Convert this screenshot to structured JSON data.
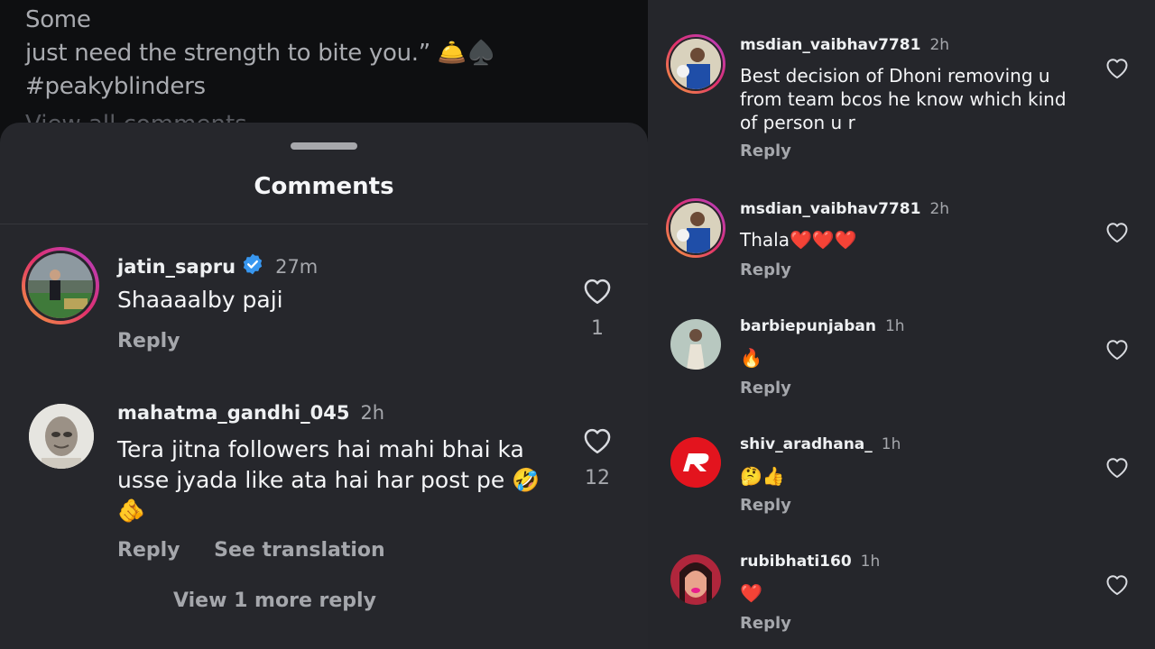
{
  "post": {
    "caption_line1": "Some",
    "caption_line2": "just need the strength to bite you.” 🛎️♠️",
    "hashtag": "#peakyblinders",
    "partial_link": "View all comments"
  },
  "sheet": {
    "title": "Comments",
    "comments": [
      {
        "username": "jatin_sapru",
        "verified": true,
        "time": "27m",
        "text": "Shaaaalby paji",
        "reply_label": "Reply",
        "likes": "1"
      },
      {
        "username": "mahatma_gandhi_045",
        "time": "2h",
        "text": "Tera jitna followers hai mahi bhai ka usse jyada like ata hai har post pe 🤣🫵",
        "reply_label": "Reply",
        "translation_label": "See translation",
        "likes": "12"
      }
    ],
    "view_more_label": "View 1 more reply"
  },
  "right_comments": [
    {
      "username": "msdian_vaibhav7781",
      "time": "2h",
      "text": "Best decision of Dhoni removing u from team bcos he know which kind of person u r",
      "reply_label": "Reply"
    },
    {
      "username": "msdian_vaibhav7781",
      "time": "2h",
      "text": "Thala❤️❤️❤️",
      "reply_label": "Reply"
    },
    {
      "username": "barbiepunjaban",
      "time": "1h",
      "text": "🔥",
      "reply_label": "Reply"
    },
    {
      "username": "shiv_aradhana_",
      "time": "1h",
      "text": "🤔👍",
      "reply_label": "Reply"
    },
    {
      "username": "rubibhati160",
      "time": "1h",
      "text": "❤️",
      "reply_label": "Reply"
    }
  ],
  "colors": {
    "sheet_bg": "#26272c",
    "right_bg": "#25262b",
    "hashtag": "#8ea1c6",
    "verified": "#3897f0",
    "secondary_text": "#a5a7ac"
  },
  "icons": [
    "heart-icon",
    "verified-badge-icon"
  ]
}
